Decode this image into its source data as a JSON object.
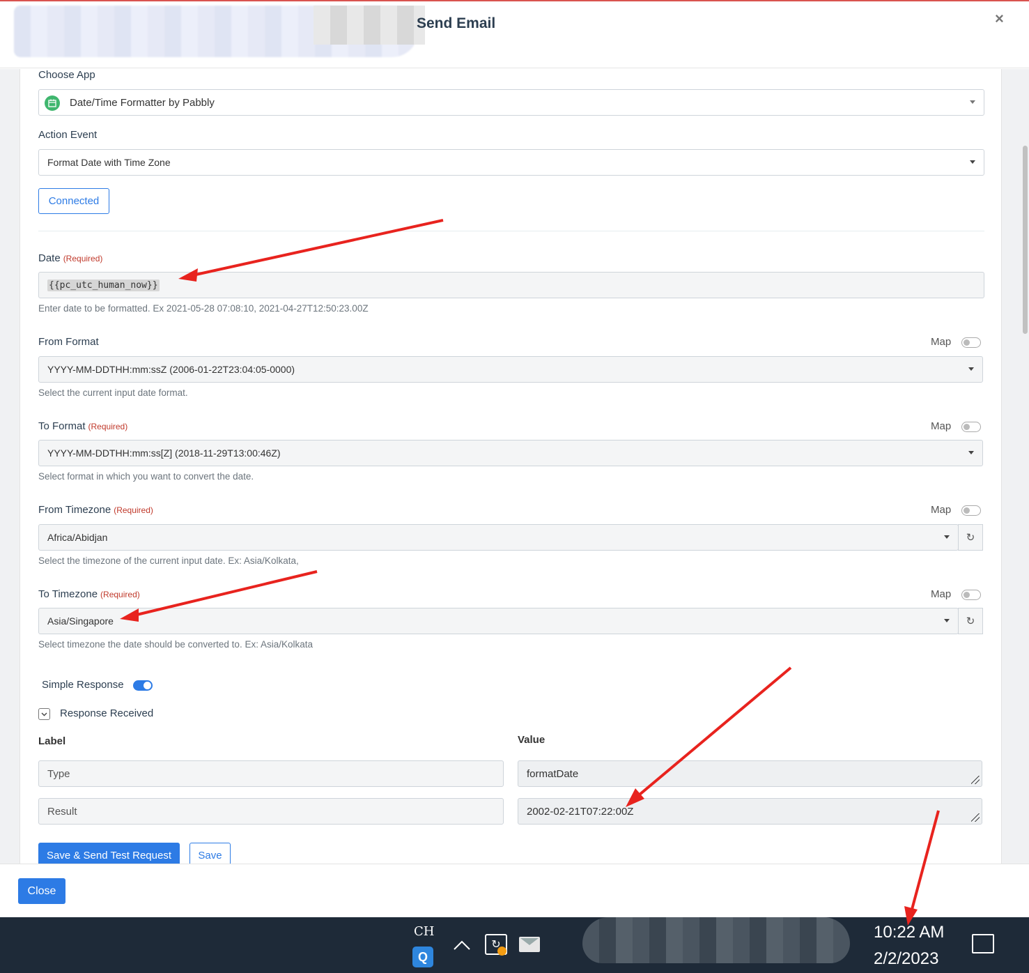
{
  "modal": {
    "title": "Send Email",
    "close_symbol": "×"
  },
  "choose_app": {
    "label": "Choose App",
    "value": "Date/Time Formatter by Pabbly",
    "icon": "calendar-icon"
  },
  "action_event": {
    "label": "Action Event",
    "value": "Format Date with Time Zone"
  },
  "connected_button": "Connected",
  "required_text": "(Required)",
  "map_label": "Map",
  "date_field": {
    "label": "Date",
    "value": "{{pc_utc_human_now}}",
    "help": "Enter date to be formatted. Ex 2021-05-28 07:08:10, 2021-04-27T12:50:23.00Z"
  },
  "from_format": {
    "label": "From Format",
    "value": "YYYY-MM-DDTHH:mm:ssZ (2006-01-22T23:04:05-0000)",
    "help": "Select the current input date format."
  },
  "to_format": {
    "label": "To Format",
    "value": "YYYY-MM-DDTHH:mm:ss[Z] (2018-11-29T13:00:46Z)",
    "help": "Select format in which you want to convert the date."
  },
  "from_timezone": {
    "label": "From Timezone",
    "value": "Africa/Abidjan",
    "help": "Select the timezone of the current input date. Ex: Asia/Kolkata,"
  },
  "to_timezone": {
    "label": "To Timezone",
    "value": "Asia/Singapore",
    "help": "Select timezone the date should be converted to. Ex: Asia/Kolkata"
  },
  "simple_response": {
    "label": "Simple Response",
    "enabled": true
  },
  "response_received": {
    "label": "Response Received",
    "col_label": "Label",
    "col_value": "Value",
    "rows": [
      {
        "label": "Type",
        "value": "formatDate"
      },
      {
        "label": "Result",
        "value": "2002-02-21T07:22:00Z"
      }
    ]
  },
  "buttons": {
    "save_send": "Save & Send Test Request",
    "save": "Save",
    "close": "Close"
  },
  "taskbar": {
    "lang": "CH",
    "q_app": "Q",
    "tray_up": "^",
    "time": "10:22 AM",
    "date": "2/2/2023"
  },
  "colors": {
    "accent": "#2d7be5",
    "required": "#c0392b",
    "annotation_arrow": "#e8231e",
    "taskbar": "#1e2a38"
  }
}
